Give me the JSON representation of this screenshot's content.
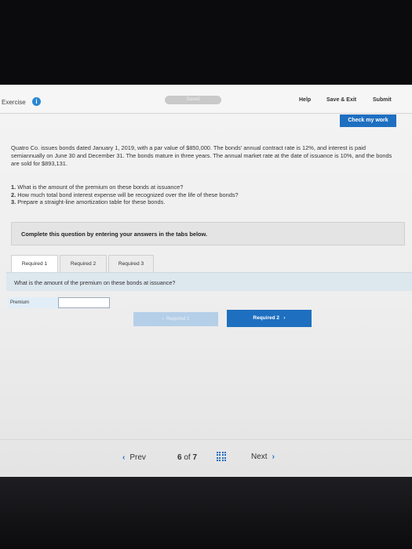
{
  "header": {
    "exercise_label": "Exercise",
    "info_icon": "i",
    "saved_label": "Saved",
    "help_label": "Help",
    "save_exit_label": "Save & Exit",
    "submit_label": "Submit"
  },
  "check_my_work_label": "Check my work",
  "problem_text": "Quatro Co. issues bonds dated January 1, 2019, with a par value of $850,000. The bonds' annual contract rate is 12%, and interest is paid semiannually on June 30 and December 31. The bonds mature in three years. The annual market rate at the date of issuance is 10%, and the bonds are sold for $893,131.",
  "questions": [
    {
      "num": "1.",
      "text": "What is the amount of the premium on these bonds at issuance?"
    },
    {
      "num": "2.",
      "text": "How much total bond interest expense will be recognized over the life of these bonds?"
    },
    {
      "num": "3.",
      "text": "Prepare a straight-line amortization table for these bonds."
    }
  ],
  "instruction": "Complete this question by entering your answers in the tabs below.",
  "tabs": [
    "Required 1",
    "Required 2",
    "Required 3"
  ],
  "active_tab": 0,
  "required_question": "What is the amount of the premium on these bonds at issuance?",
  "premium_label": "Premium",
  "premium_value": "",
  "nav_buttons": {
    "prev_label": "Required 1",
    "next_label": "Required 2"
  },
  "footer": {
    "prev_label": "Prev",
    "current_page": "6",
    "of_label": "of",
    "total_pages": "7",
    "next_label": "Next"
  },
  "colors": {
    "accent": "#1e6fc0",
    "panel": "#dde7ee"
  }
}
